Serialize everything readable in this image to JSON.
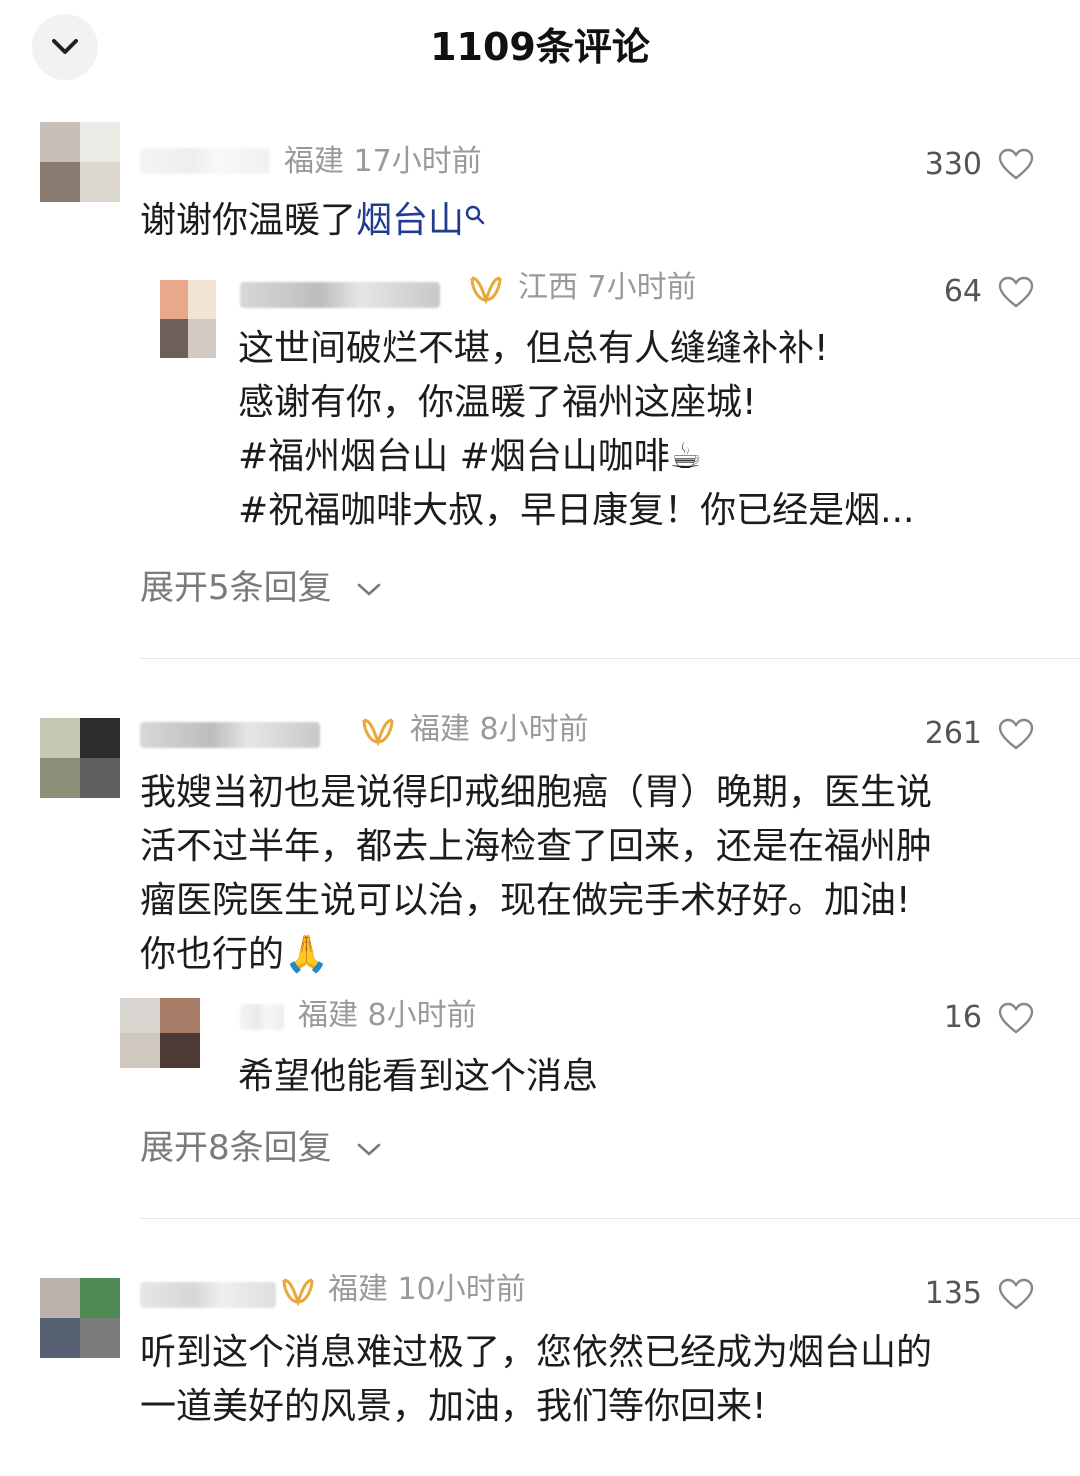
{
  "header": {
    "title": "1109条评论"
  },
  "comments": [
    {
      "meta": "福建 17小时前",
      "likes": "330",
      "text_prefix": "谢谢你温暖了",
      "text_link": "烟台山",
      "reply": {
        "meta": "江西 7小时前",
        "likes": "64",
        "lines": [
          "这世间破烂不堪，但总有人缝缝补补!",
          "感谢有你，你温暖了福州这座城!",
          "#福州烟台山 #烟台山咖啡☕",
          "#祝福咖啡大叔，早日康复！你已经是烟..."
        ]
      },
      "expand": "展开5条回复"
    },
    {
      "meta": "福建 8小时前",
      "likes": "261",
      "lines": [
        "我嫂当初也是说得印戒细胞癌（胃）晚期，医生说",
        "活不过半年，都去上海检查了回来，还是在福州肿",
        "瘤医院医生说可以治，现在做完手术好好。加油!",
        "你也行的🙏"
      ],
      "reply": {
        "meta": "福建 8小时前",
        "likes": "16",
        "lines": [
          "希望他能看到这个消息"
        ]
      },
      "expand": "展开8条回复"
    },
    {
      "meta": "福建 10小时前",
      "likes": "135",
      "lines": [
        "听到这个消息难过极了，您依然已经成为烟台山的",
        "一道美好的风景，加油，我们等你回来!"
      ]
    }
  ],
  "icons": {
    "back": "chevron-down-icon",
    "like": "heart-outline-icon",
    "search": "search-icon",
    "badge": "fan-badge-icon",
    "expand": "chevron-down-icon"
  },
  "colors": {
    "link": "#1f3c8f",
    "badge": "#e8a83a",
    "meta": "#9a9a9a"
  }
}
